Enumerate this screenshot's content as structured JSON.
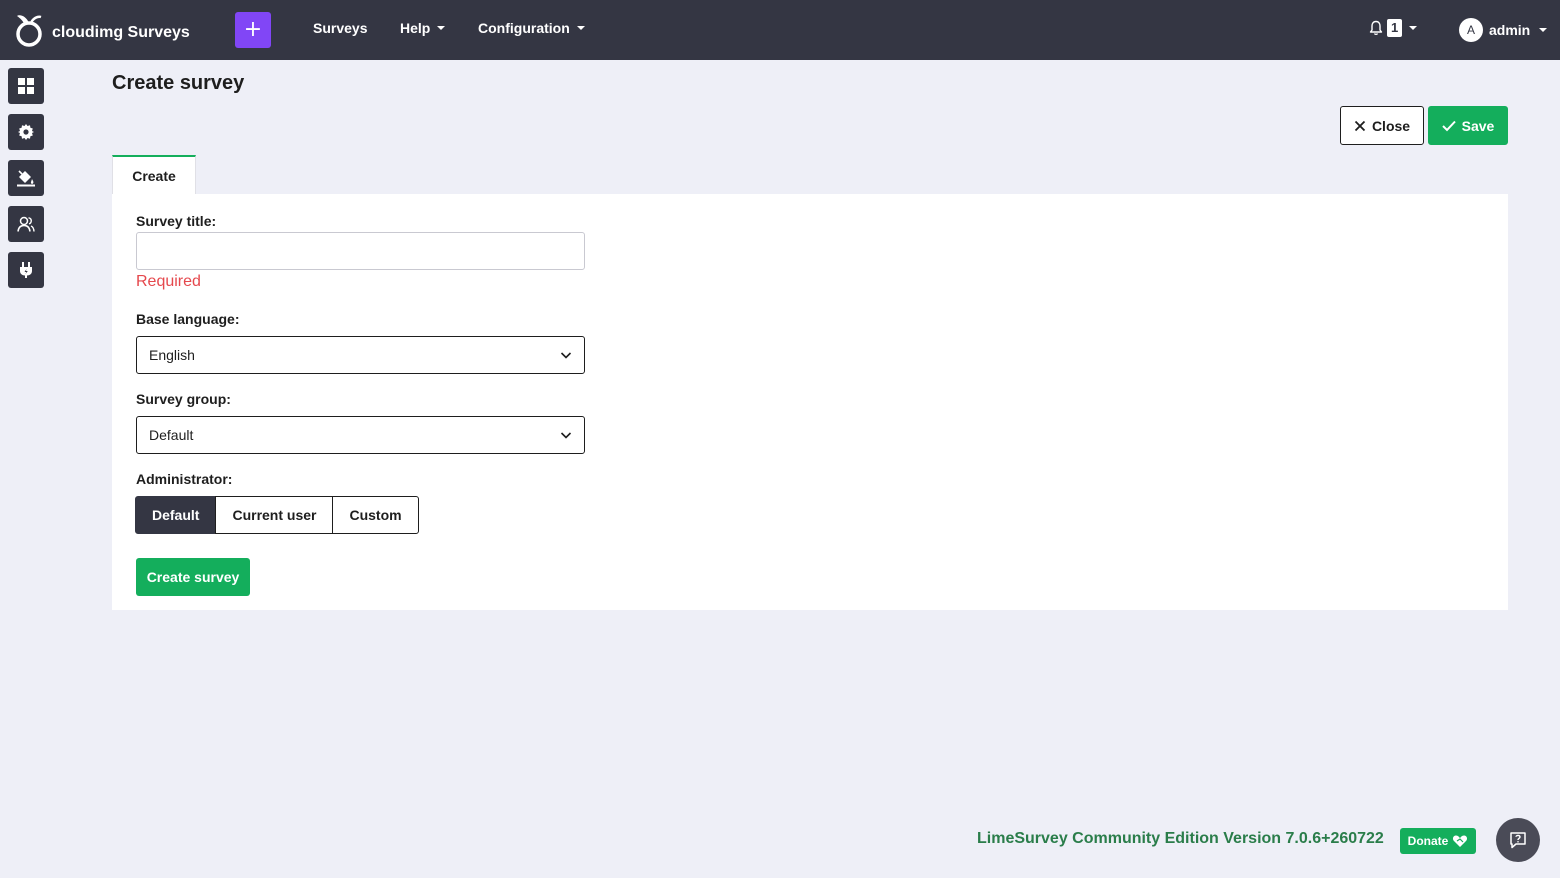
{
  "header": {
    "brand": "cloudimg Surveys",
    "plus_label": "+",
    "nav": {
      "surveys": "Surveys",
      "help": "Help",
      "configuration": "Configuration"
    },
    "notifications_count": "1",
    "user_initial": "A",
    "user_name": "admin"
  },
  "sidebar": {
    "items": [
      {
        "icon": "dashboard-grid-icon"
      },
      {
        "icon": "gear-icon"
      },
      {
        "icon": "paint-bucket-icon"
      },
      {
        "icon": "users-icon"
      },
      {
        "icon": "plug-icon"
      }
    ]
  },
  "page": {
    "title": "Create survey",
    "close_label": "Close",
    "save_label": "Save",
    "tab_label": "Create"
  },
  "form": {
    "survey_title_label": "Survey title:",
    "survey_title_value": "",
    "required_text": "Required",
    "base_language_label": "Base language:",
    "base_language_value": "English",
    "survey_group_label": "Survey group:",
    "survey_group_value": "Default",
    "administrator_label": "Administrator:",
    "administrator_options": [
      "Default",
      "Current user",
      "Custom"
    ],
    "administrator_selected": "Default",
    "create_button": "Create survey"
  },
  "footer": {
    "version": "LimeSurvey Community Edition Version 7.0.6+260722",
    "donate": "Donate"
  },
  "colors": {
    "topbar": "#343643",
    "accent_purple": "#8146f6",
    "success_green": "#14ae5c",
    "error_red": "#e5484d"
  }
}
